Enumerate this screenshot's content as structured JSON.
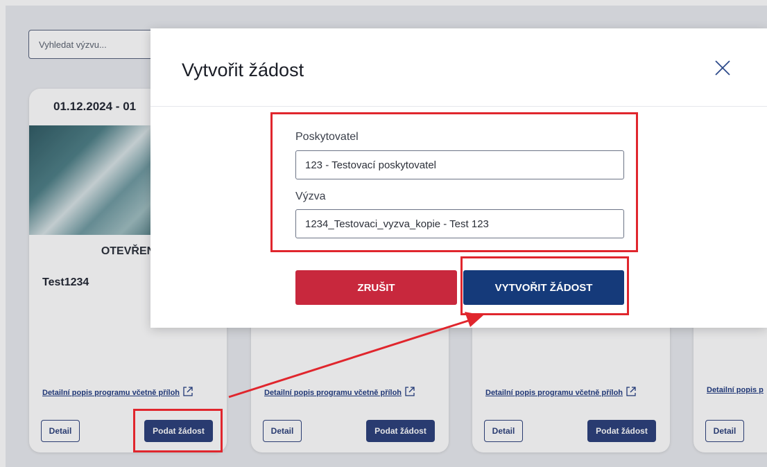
{
  "search": {
    "placeholder": "Vyhledat výzvu..."
  },
  "cards": [
    {
      "date": "01.12.2024 - 01",
      "status": "OTEVŘEN",
      "name": "Test1234",
      "link_label": "Detailní popis programu včetně příloh",
      "detail_label": "Detail",
      "apply_label": "Podat žádost"
    },
    {
      "link_label": "Detailní popis programu včetně příloh",
      "detail_label": "Detail",
      "apply_label": "Podat žádost"
    },
    {
      "link_label": "Detailní popis programu včetně příloh",
      "detail_label": "Detail",
      "apply_label": "Podat žádost"
    },
    {
      "link_label": "Detailní popis p",
      "detail_label": "Detail"
    }
  ],
  "modal": {
    "title": "Vytvořit žádost",
    "provider_label": "Poskytovatel",
    "provider_value": "123 - Testovací poskytovatel",
    "call_label": "Výzva",
    "call_value": "1234_Testovaci_vyzva_kopie - Test 123",
    "cancel_label": "ZRUŠIT",
    "create_label": "VYTVOŘIT ŽÁDOST"
  },
  "colors": {
    "primary": "#153a7a",
    "danger": "#c8283d",
    "annotation": "#e0262d"
  },
  "icons": {
    "close": "close-icon",
    "external_link": "external-link-icon"
  }
}
